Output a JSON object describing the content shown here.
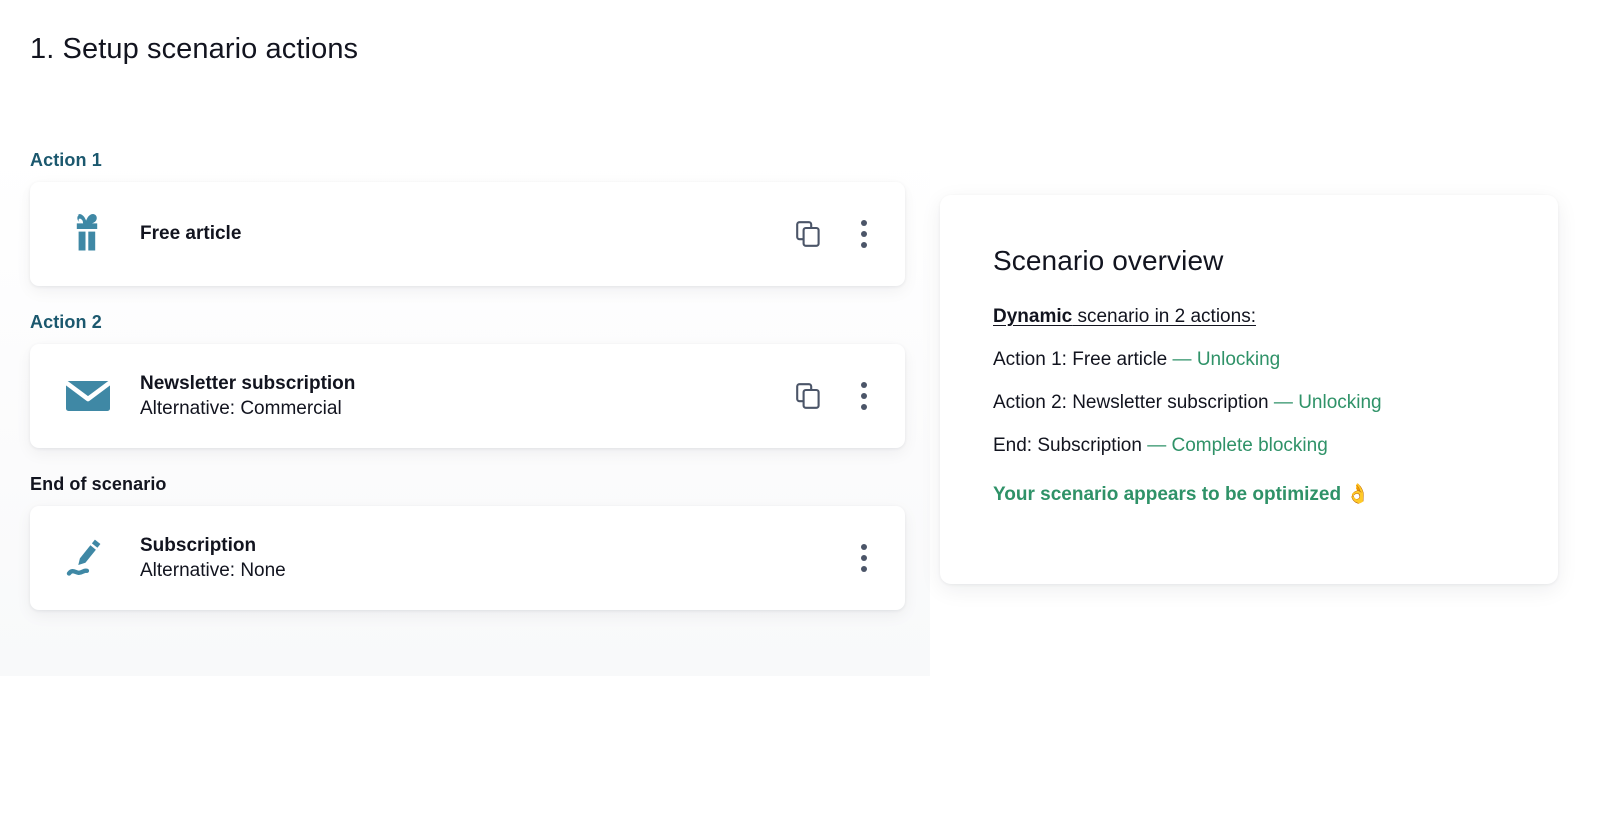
{
  "page": {
    "title": "1. Setup scenario actions",
    "accent_teal": "#1b586e",
    "icon_blue": "#3f88a5",
    "green": "#2f9268",
    "slate": "#4b5568"
  },
  "groups": [
    {
      "label": "Action 1",
      "label_style": "accent",
      "card": {
        "icon": "gift-icon",
        "title": "Free article",
        "subtitle": "",
        "has_duplicate": true,
        "has_menu": true
      }
    },
    {
      "label": "Action 2",
      "label_style": "accent",
      "card": {
        "icon": "envelope-icon",
        "title": "Newsletter subscription",
        "subtitle": "Alternative: Commercial",
        "has_duplicate": true,
        "has_menu": true
      }
    },
    {
      "label": "End of scenario",
      "label_style": "dark",
      "card": {
        "icon": "signature-pen-icon",
        "title": "Subscription",
        "subtitle": "Alternative: None",
        "has_duplicate": false,
        "has_menu": true
      }
    }
  ],
  "overview": {
    "title": "Scenario overview",
    "summary_bold": "Dynamic",
    "summary_rest": " scenario in 2 actions:",
    "lines": [
      {
        "label": "Action 1: Free article",
        "sep": " — ",
        "value": "Unlocking"
      },
      {
        "label": "Action 2: Newsletter subscription",
        "sep": " — ",
        "value": "Unlocking"
      },
      {
        "label": "End: Subscription",
        "sep": " — ",
        "value": "Complete blocking"
      }
    ],
    "status_text": "Your scenario appears to be optimized",
    "status_emoji": "👌"
  }
}
